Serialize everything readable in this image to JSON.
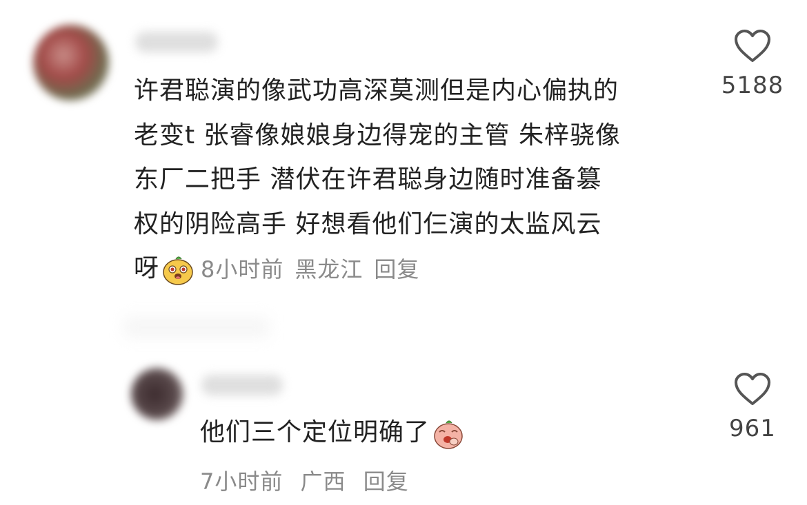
{
  "comment": {
    "lines": [
      "许君聪演的像武功高深莫测但是内心偏执的",
      "老变t 张睿像娘娘身边得宠的主管 朱梓骁像",
      "东厂二把手 潜伏在许君聪身边随时准备篡",
      "权的阴险高手 好想看他们仨演的太监风云"
    ],
    "last_line": "呀",
    "emoji_icon": "cute-face-emoji",
    "time": "8小时前",
    "location": "黑龙江",
    "reply_label": "回复",
    "likes": "5188"
  },
  "reply": {
    "text": "他们三个定位明确了",
    "emoji_icon": "laughing-peach-emoji",
    "time": "7小时前",
    "location": "广西",
    "reply_label": "回复",
    "likes": "961"
  }
}
